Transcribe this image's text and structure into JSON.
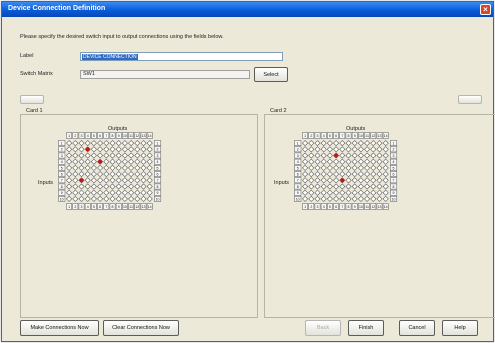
{
  "window": {
    "title": "Device Connection Definition"
  },
  "instructions": "Please specify the desired switch input to output connections using the fields below.",
  "label_field": {
    "label": "Label",
    "value": "DEVICE CONNECTION"
  },
  "switch_matrix": {
    "label": "Switch Matrix",
    "value": "SW1",
    "select_label": "Select"
  },
  "cards": [
    {
      "title": "Card 1",
      "outputs_label": "Outputs",
      "inputs_label": "Inputs",
      "connections": [
        {
          "input": 2,
          "output": 4
        },
        {
          "input": 4,
          "output": 6
        },
        {
          "input": 7,
          "output": 3
        }
      ]
    },
    {
      "title": "Card 2",
      "outputs_label": "Outputs",
      "inputs_label": "Inputs",
      "connections": [
        {
          "input": 3,
          "output": 6
        },
        {
          "input": 7,
          "output": 7
        }
      ]
    }
  ],
  "grid": {
    "output_headers": [
      "1",
      "2",
      "3",
      "4",
      "5",
      "6",
      "7",
      "8",
      "9",
      "10",
      "11",
      "12",
      "13",
      "14"
    ],
    "input_headers": [
      "1",
      "2",
      "3",
      "4",
      "5",
      "6",
      "7",
      "8",
      "9",
      "10"
    ]
  },
  "buttons": {
    "make_connections": "Make Connections Now",
    "clear_connections": "Clear Connections Now",
    "back": "Back",
    "finish": "Finish",
    "cancel": "Cancel",
    "help": "Help"
  },
  "colors": {
    "title_bar": "#0a5bd8",
    "connection": "#c0171b",
    "selection": "#316ac5"
  }
}
